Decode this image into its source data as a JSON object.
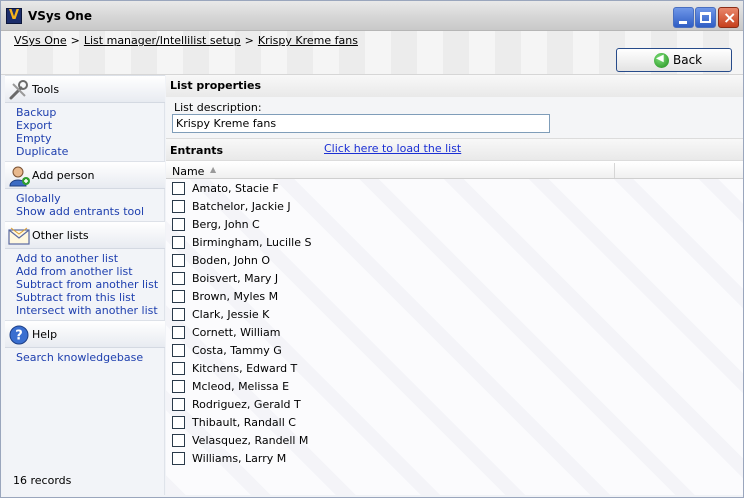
{
  "window": {
    "title": "VSys One"
  },
  "breadcrumb": [
    {
      "label": "VSys One"
    },
    {
      "label": "List manager/Intellilist setup"
    },
    {
      "label": "Krispy Kreme fans"
    }
  ],
  "breadcrumb_separator": ">",
  "back_button": {
    "label": "Back"
  },
  "sidebar": {
    "tools": {
      "label": "Tools",
      "icon": "tools-icon",
      "links": [
        "Backup",
        "Export",
        "Empty",
        "Duplicate"
      ]
    },
    "add_person": {
      "label": "Add person",
      "icon": "add-person-icon",
      "links": [
        "Globally",
        "Show add entrants tool"
      ]
    },
    "other_lists": {
      "label": "Other lists",
      "icon": "envelope-icon",
      "links": [
        "Add to another list",
        "Add from another list",
        "Subtract from another list",
        "Subtract from this list",
        "Intersect with another list"
      ]
    },
    "help": {
      "label": "Help",
      "icon": "help-icon",
      "links": [
        "Search knowledgebase"
      ]
    },
    "records": "16 records"
  },
  "list_properties": {
    "title": "List properties",
    "description_label": "List description:",
    "description_value": "Krispy Kreme fans"
  },
  "entrants": {
    "title": "Entrants",
    "load_link": "Click here to load the list",
    "column_name": "Name",
    "sort_indicator": "▲",
    "rows": [
      "Amato, Stacie F",
      "Batchelor, Jackie J",
      "Berg, John C",
      "Birmingham, Lucille S",
      "Boden, John O",
      "Boisvert, Mary J",
      "Brown, Myles M",
      "Clark, Jessie K",
      "Cornett, William",
      "Costa, Tammy G",
      "Kitchens, Edward T",
      "Mcleod, Melissa E",
      "Rodriguez, Gerald T",
      "Thibault, Randall C",
      "Velasquez, Randell M",
      "Williams, Larry M"
    ]
  },
  "colors": {
    "link": "#1e3fae",
    "load_link": "#1b2fd4",
    "accent": "#274b8a"
  }
}
